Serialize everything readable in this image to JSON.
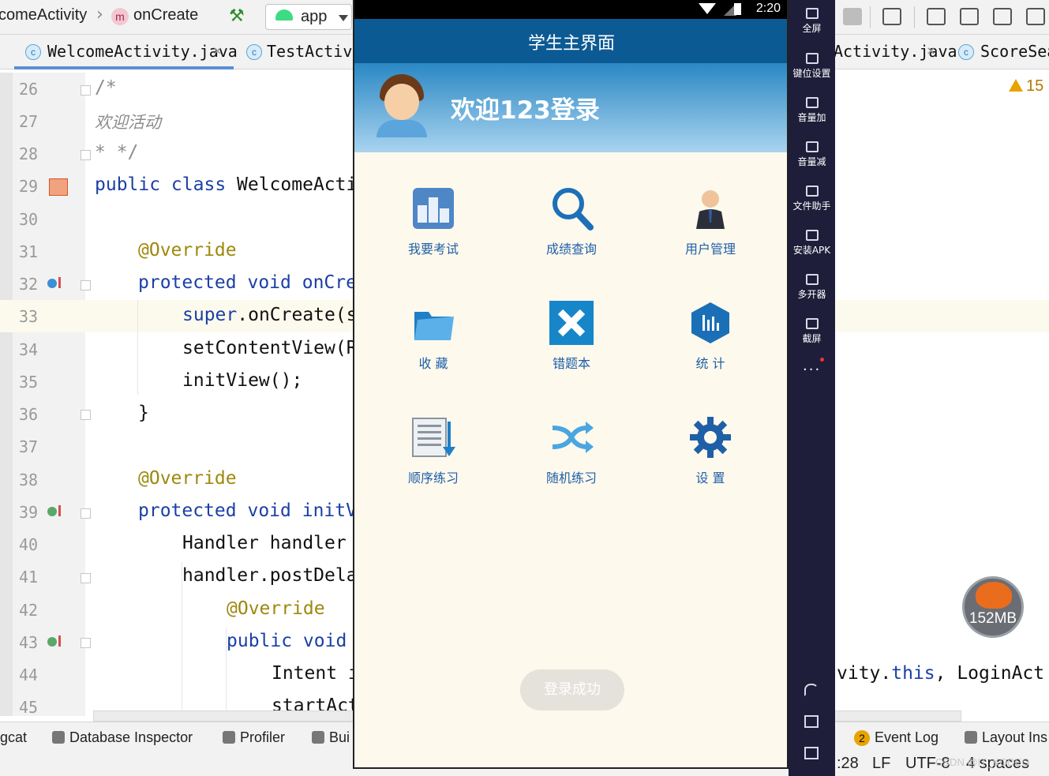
{
  "ide": {
    "breadcrumb": {
      "class_name": "comeActivity",
      "method": "onCreate",
      "method_badge": "m"
    },
    "run_config": "app",
    "tabs": [
      {
        "label": "WelcomeActivity.java",
        "icon": "c-class-icon",
        "active": true
      },
      {
        "label": "TestActivity"
      },
      {
        "label": "Activity.java"
      },
      {
        "label": "ScoreSea"
      }
    ],
    "warnings_count": "15",
    "line_numbers": [
      "26",
      "27",
      "28",
      "29",
      "30",
      "31",
      "32",
      "33",
      "34",
      "35",
      "36",
      "37",
      "38",
      "39",
      "40",
      "41",
      "42",
      "43",
      "44",
      "45"
    ],
    "code": {
      "l26": "/*",
      "l27": "欢迎活动",
      "l28": "* */",
      "l29_kw": "public class",
      "l29_rest": " WelcomeActi",
      "l31": "@Override",
      "l32_kw": "protected void",
      "l32_rest": " onCre",
      "l33_kw": "super",
      "l33_rest": ".onCreate(s",
      "l34": "setContentView(R",
      "l35": "initView();",
      "l36": "}",
      "l38": "@Override",
      "l39_kw": "protected void",
      "l39_rest": " initV",
      "l40": "Handler handler",
      "l41": "handler.postDela",
      "l42": "@Override",
      "l43_kw": "public void",
      "l44_left": "Intent i",
      "l44_right_a": "vity.",
      "l44_right_kw": "this",
      "l44_right_b": ", LoginAct",
      "l45": "startAct"
    },
    "memory": "152MB",
    "bottom_tools": {
      "logcat": "gcat",
      "database_inspector": "Database Inspector",
      "profiler": "Profiler",
      "build": "Bui",
      "event_log": "Event Log",
      "event_log_count": "2",
      "layout_inspector": "Layout Ins"
    },
    "status": {
      "position": ":28",
      "line_sep": "LF",
      "encoding": "UTF-8",
      "indent": "4 spaces"
    },
    "watermark": "CSDN @IT_KODEO"
  },
  "emulator": {
    "status_time": "2:20",
    "title": "学生主界面",
    "welcome": "欢迎123登录",
    "grid": [
      {
        "label": "我要考试",
        "icon": "podium-icon"
      },
      {
        "label": "成绩查询",
        "icon": "magnifier-icon"
      },
      {
        "label": "用户管理",
        "icon": "user-icon"
      },
      {
        "label": "收  藏",
        "icon": "folder-icon"
      },
      {
        "label": "错题本",
        "icon": "error-x-icon"
      },
      {
        "label": "统  计",
        "icon": "stats-hexagon-icon"
      },
      {
        "label": "顺序练习",
        "icon": "list-down-icon"
      },
      {
        "label": "随机练习",
        "icon": "shuffle-icon"
      },
      {
        "label": "设  置",
        "icon": "gear-icon"
      }
    ],
    "toast": "登录成功",
    "side_panel": [
      {
        "label": "全屏",
        "icon": "fullscreen-icon"
      },
      {
        "label": "键位设置",
        "icon": "keyboard-icon"
      },
      {
        "label": "音量加",
        "icon": "volume-up-icon"
      },
      {
        "label": "音量减",
        "icon": "volume-down-icon"
      },
      {
        "label": "文件助手",
        "icon": "file-helper-icon"
      },
      {
        "label": "安装APK",
        "icon": "install-apk-icon"
      },
      {
        "label": "多开器",
        "icon": "multi-instance-icon"
      },
      {
        "label": "截屏",
        "icon": "scissors-icon"
      }
    ],
    "more": "..."
  }
}
